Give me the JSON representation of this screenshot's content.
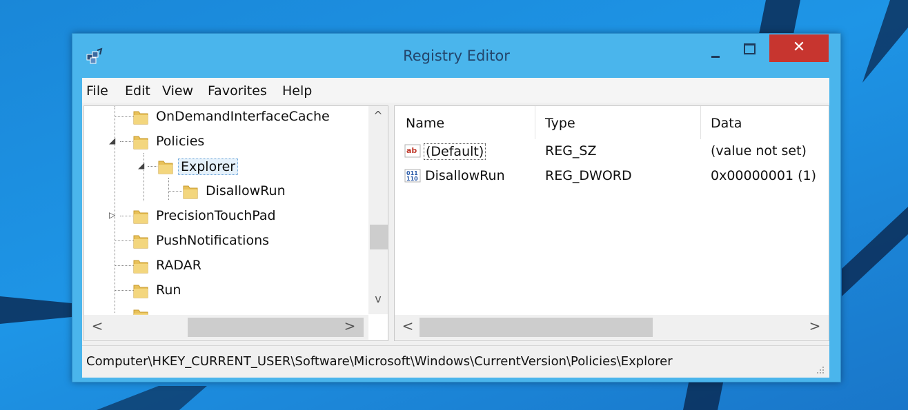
{
  "window": {
    "title": "Registry Editor",
    "close_glyph": "✕"
  },
  "menu": [
    "File",
    "Edit",
    "View",
    "Favorites",
    "Help"
  ],
  "tree": {
    "nodes": [
      {
        "label": "OnDemandInterfaceCache",
        "expander": "",
        "level": 0
      },
      {
        "label": "Policies",
        "expander": "◢",
        "level": 0
      },
      {
        "label": "Explorer",
        "expander": "◢",
        "level": 1,
        "selected": true
      },
      {
        "label": "DisallowRun",
        "expander": "",
        "level": 2
      },
      {
        "label": "PrecisionTouchPad",
        "expander": "▷",
        "level": 0
      },
      {
        "label": "PushNotifications",
        "expander": "",
        "level": 0
      },
      {
        "label": "RADAR",
        "expander": "",
        "level": 0
      },
      {
        "label": "Run",
        "expander": "",
        "level": 0
      }
    ],
    "scroll_up": "^",
    "scroll_down": "v",
    "scroll_left": "<",
    "scroll_right": ">"
  },
  "list": {
    "columns": [
      "Name",
      "Type",
      "Data"
    ],
    "rows": [
      {
        "icon": "string-value-icon",
        "name": "(Default)",
        "type": "REG_SZ",
        "data": "(value not set)"
      },
      {
        "icon": "dword-value-icon",
        "name": "DisallowRun",
        "type": "REG_DWORD",
        "data": "0x00000001 (1)"
      }
    ],
    "scroll_left": "<",
    "scroll_right": ">"
  },
  "status": {
    "path": "Computer\\HKEY_CURRENT_USER\\Software\\Microsoft\\Windows\\CurrentVersion\\Policies\\Explorer"
  },
  "colors": {
    "title_bar": "#4ab5ec",
    "close_button": "#c7352f",
    "desktop": "#1e8fe0"
  }
}
